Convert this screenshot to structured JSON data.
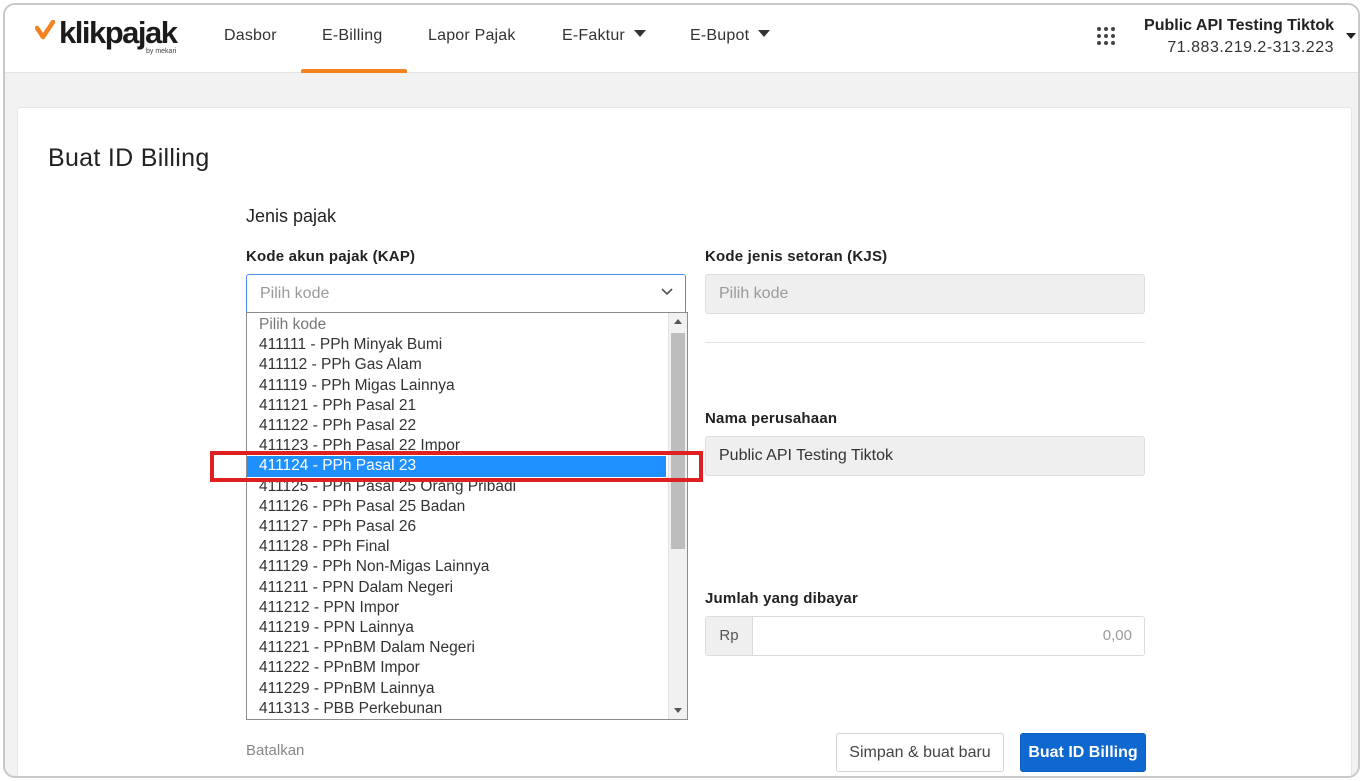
{
  "brand": {
    "logo_text": "klikpajak",
    "logo_sub": "by mekari"
  },
  "nav": {
    "items": [
      {
        "label": "Dasbor"
      },
      {
        "label": "E-Billing"
      },
      {
        "label": "Lapor Pajak"
      },
      {
        "label": "E-Faktur"
      },
      {
        "label": "E-Bupot"
      }
    ],
    "active": "E-Billing"
  },
  "company": {
    "name": "Public API Testing Tiktok",
    "npwp": "71.883.219.2-313.223"
  },
  "page": {
    "title": "Buat ID Billing",
    "section_title": "Jenis pajak"
  },
  "form": {
    "kap_label": "Kode akun pajak (KAP)",
    "kap_placeholder": "Pilih kode",
    "kjs_label": "Kode jenis setoran (KJS)",
    "kjs_placeholder": "Pilih kode",
    "company_label": "Nama perusahaan",
    "company_value": "Public API Testing Tiktok",
    "amount_label": "Jumlah yang dibayar",
    "amount_prefix": "Rp",
    "amount_placeholder": "0,00"
  },
  "dropdown": {
    "options": [
      "Pilih kode",
      "411111 - PPh Minyak Bumi",
      "411112 - PPh Gas Alam",
      "411119 - PPh Migas Lainnya",
      "411121 - PPh Pasal 21",
      "411122 - PPh Pasal 22",
      "411123 - PPh Pasal 22 Impor",
      "411124 - PPh Pasal 23",
      "411125 - PPh Pasal 25 Orang Pribadi",
      "411126 - PPh Pasal 25 Badan",
      "411127 - PPh Pasal 26",
      "411128 - PPh Final",
      "411129 - PPh Non-Migas Lainnya",
      "411211 - PPN Dalam Negeri",
      "411212 - PPN Impor",
      "411219 - PPN Lainnya",
      "411221 - PPnBM Dalam Negeri",
      "411222 - PPnBM Impor",
      "411229 - PPnBM Lainnya",
      "411313 - PBB Perkebunan"
    ],
    "selected": "411124 - PPh Pasal 23"
  },
  "actions": {
    "cancel_label": "Batalkan",
    "save_new_label": "Simpan & buat baru",
    "create_label": "Buat ID Billing"
  },
  "colors": {
    "accent": "#f5821f",
    "primary_button": "#0f67d0",
    "selected_option": "#1e90ff",
    "highlight_box": "#e02020"
  },
  "icons": {
    "apps": "grid-dots-icon",
    "chevron": "chevron-down-icon",
    "logo_mark": "check-mark-icon"
  }
}
